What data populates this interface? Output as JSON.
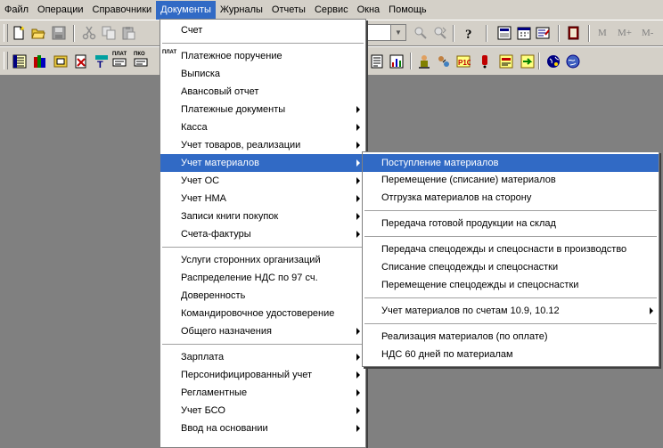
{
  "menubar": {
    "items": [
      "Файл",
      "Операции",
      "Справочники",
      "Документы",
      "Журналы",
      "Отчеты",
      "Сервис",
      "Окна",
      "Помощь"
    ],
    "active_index": 3
  },
  "toolbar": {
    "memory_labels": [
      "M",
      "M+",
      "M-"
    ],
    "plat_caption": "ПЛАТ",
    "pko_caption": "ПКО",
    "icons_row1": [
      "new-document-icon",
      "open-folder-icon",
      "save-icon",
      "cut-icon",
      "copy-icon",
      "paste-icon",
      "search-icon",
      "find-next-icon",
      "help-icon",
      "calculator-icon",
      "calendar-icon",
      "journal-icon",
      "book-icon"
    ],
    "icons_row2": [
      "catalog-icon",
      "books-icon",
      "folders-icon",
      "cancel-doc-icon",
      "account-plan-icon",
      "plat-doc-icon",
      "pko-doc-icon",
      "report-icon",
      "chart-icon",
      "people-icon",
      "transfer-icon",
      "tax-icon",
      "alert-icon",
      "note-icon",
      "export-icon",
      "globe-icon",
      "world-icon"
    ]
  },
  "documents_menu": {
    "items": [
      {
        "label": "Счет",
        "submenu": false
      },
      {
        "separator": true
      },
      {
        "label": "Платежное поручение",
        "submenu": false,
        "icon": "ПЛАТ"
      },
      {
        "label": "Выписка",
        "submenu": false
      },
      {
        "label": "Авансовый отчет",
        "submenu": false
      },
      {
        "label": "Платежные документы",
        "submenu": true
      },
      {
        "label": "Касса",
        "submenu": true
      },
      {
        "label": "Учет товаров, реализации",
        "submenu": true
      },
      {
        "label": "Учет материалов",
        "submenu": true,
        "highlighted": true
      },
      {
        "label": "Учет ОС",
        "submenu": true
      },
      {
        "label": "Учет НМА",
        "submenu": true
      },
      {
        "label": "Записи книги покупок",
        "submenu": true
      },
      {
        "label": "Счета-фактуры",
        "submenu": true
      },
      {
        "separator": true
      },
      {
        "label": "Услуги сторонних организаций",
        "submenu": false
      },
      {
        "label": "Распределение НДС по 97 сч.",
        "submenu": false
      },
      {
        "label": "Доверенность",
        "submenu": false
      },
      {
        "label": "Командировочное удостоверение",
        "submenu": false
      },
      {
        "label": "Общего назначения",
        "submenu": true
      },
      {
        "separator": true
      },
      {
        "label": "Зарплата",
        "submenu": true
      },
      {
        "label": "Персонифицированный учет",
        "submenu": true
      },
      {
        "label": "Регламентные",
        "submenu": true
      },
      {
        "label": "Учет БСО",
        "submenu": true
      },
      {
        "label": "Ввод на основании",
        "submenu": true
      }
    ]
  },
  "materials_submenu": {
    "items": [
      {
        "label": "Поступление материалов",
        "submenu": false,
        "highlighted": true
      },
      {
        "label": "Перемещение (списание) материалов",
        "submenu": false
      },
      {
        "label": "Отгрузка материалов на сторону",
        "submenu": false
      },
      {
        "separator": true
      },
      {
        "label": "Передача готовой продукции на склад",
        "submenu": false
      },
      {
        "separator": true
      },
      {
        "label": "Передача спецодежды и спецоснасти в производство",
        "submenu": false
      },
      {
        "label": "Списание спецодежды и спецоснастки",
        "submenu": false
      },
      {
        "label": "Перемещение спецодежды и спецоснастки",
        "submenu": false
      },
      {
        "separator": true
      },
      {
        "label": "Учет материалов по счетам 10.9, 10.12",
        "submenu": true
      },
      {
        "separator": true
      },
      {
        "label": "Реализация материалов (по оплате)",
        "submenu": false
      },
      {
        "label": "НДС 60 дней по материалам",
        "submenu": false
      }
    ]
  },
  "colors": {
    "highlight": "#316ac5",
    "face": "#d4d0c8",
    "workspace": "#808080"
  }
}
